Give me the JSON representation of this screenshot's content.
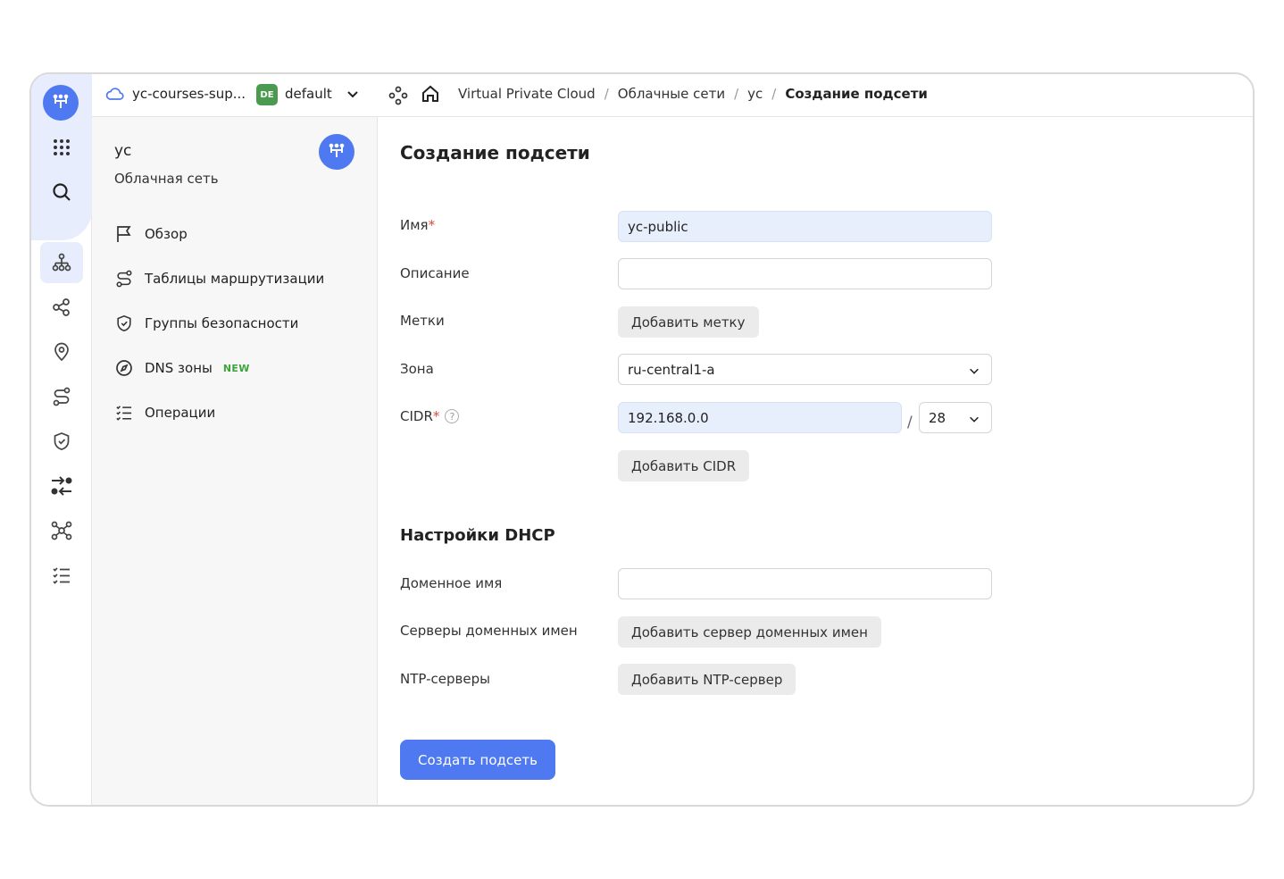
{
  "topbar": {
    "cloud_name": "yc-courses-sup...",
    "folder_badge": "DE",
    "folder_name": "default",
    "breadcrumbs": [
      "Virtual Private Cloud",
      "Облачные сети",
      "yc",
      "Создание подсети"
    ]
  },
  "rail": {
    "icons": [
      "grid-icon",
      "search-icon",
      "network-icon",
      "share-icon",
      "location-icon",
      "route-icon",
      "shield-icon",
      "transfer-icon",
      "hub-icon",
      "operations-icon"
    ]
  },
  "sidenav": {
    "title": "yc",
    "subtitle": "Облачная сеть",
    "items": [
      {
        "label": "Обзор",
        "icon": "flag-icon"
      },
      {
        "label": "Таблицы маршрутизации",
        "icon": "route-icon"
      },
      {
        "label": "Группы безопасности",
        "icon": "shield-icon"
      },
      {
        "label": "DNS зоны",
        "icon": "compass-icon",
        "badge": "NEW"
      },
      {
        "label": "Операции",
        "icon": "operations-icon"
      }
    ]
  },
  "form": {
    "title": "Создание подсети",
    "name_label": "Имя",
    "name_value": "yc-public",
    "description_label": "Описание",
    "description_value": "",
    "labels_label": "Метки",
    "add_label_button": "Добавить метку",
    "zone_label": "Зона",
    "zone_value": "ru-central1-a",
    "cidr_label": "CIDR",
    "cidr_value": "192.168.0.0",
    "cidr_slash": "/",
    "cidr_mask": "28",
    "add_cidr_button": "Добавить CIDR",
    "dhcp_title": "Настройки DHCP",
    "domain_name_label": "Доменное имя",
    "domain_name_value": "",
    "dns_servers_label": "Серверы доменных имен",
    "add_dns_button": "Добавить сервер доменных имен",
    "ntp_label": "NTP-серверы",
    "add_ntp_button": "Добавить NTP-сервер",
    "submit_button": "Создать подсеть",
    "required_mark": "*"
  },
  "colors": {
    "accent": "#4e79f0",
    "folder_badge": "#4a9a4f",
    "new_badge": "#3da33d",
    "required": "#e0463b"
  }
}
